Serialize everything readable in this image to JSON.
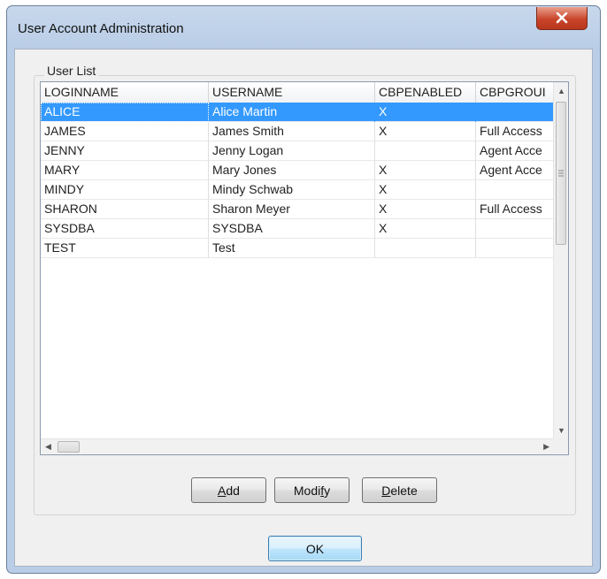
{
  "window": {
    "title": "User Account Administration"
  },
  "group": {
    "label": "User List"
  },
  "grid": {
    "columns": [
      "LOGINNAME",
      "USERNAME",
      "CBPENABLED",
      "CBPGROUI"
    ],
    "rows": [
      [
        "ALICE",
        "Alice Martin",
        "X",
        ""
      ],
      [
        "JAMES",
        "James Smith",
        "X",
        "Full Access"
      ],
      [
        "JENNY",
        "Jenny Logan",
        "",
        "Agent Acce"
      ],
      [
        "MARY",
        "Mary Jones",
        "X",
        "Agent Acce"
      ],
      [
        "MINDY",
        "Mindy Schwab",
        "X",
        ""
      ],
      [
        "SHARON",
        "Sharon Meyer",
        "X",
        "Full Access"
      ],
      [
        "SYSDBA",
        "SYSDBA",
        "X",
        ""
      ],
      [
        "TEST",
        "Test",
        "",
        ""
      ]
    ],
    "selected_row": 0
  },
  "buttons": {
    "add": {
      "accel": "A",
      "rest": "dd"
    },
    "modify": {
      "pre": "Modi",
      "accel": "f",
      "rest": "y"
    },
    "delete": {
      "accel": "D",
      "rest": "elete"
    },
    "ok": "OK"
  },
  "colors": {
    "selection": "#3399ff",
    "default_button": "#3c7fb1",
    "close_button": "#c8452a"
  }
}
